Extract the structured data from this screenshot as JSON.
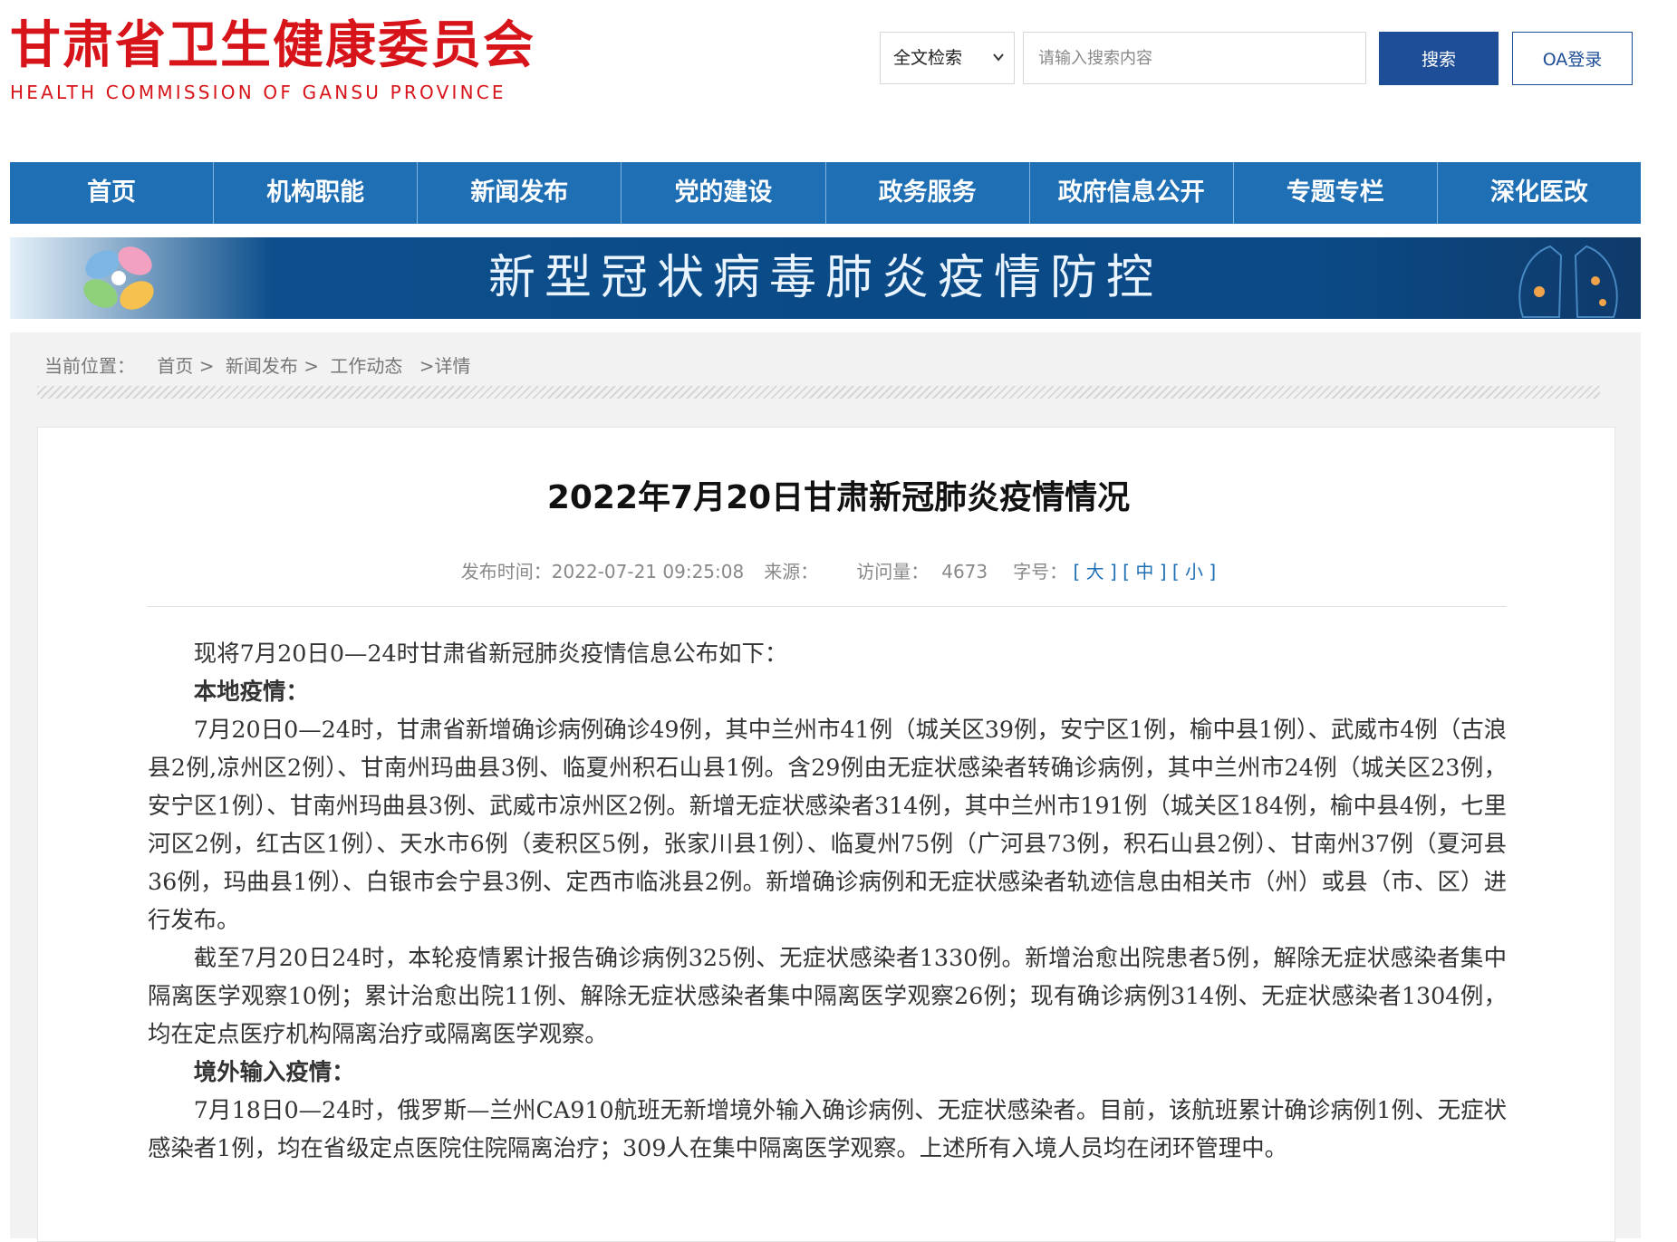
{
  "header": {
    "logo_cn": "甘肃省卫生健康委员会",
    "logo_en": "HEALTH  COMMISSION  OF  GANSU PROVINCE",
    "search_scope": "全文检索",
    "search_placeholder": "请输入搜索内容",
    "search_button": "搜索",
    "oa_button": "OA登录"
  },
  "nav": {
    "items": [
      {
        "label": "首页"
      },
      {
        "label": "机构职能"
      },
      {
        "label": "新闻发布"
      },
      {
        "label": "党的建设"
      },
      {
        "label": "政务服务"
      },
      {
        "label": "政府信息公开"
      },
      {
        "label": "专题专栏"
      },
      {
        "label": "深化医改"
      }
    ]
  },
  "banner": {
    "text": "新型冠状病毒肺炎疫情防控"
  },
  "breadcrumb": {
    "label": "当前位置：",
    "items": [
      "首页 >",
      "新闻发布 >",
      "工作动态",
      ">详情"
    ]
  },
  "article": {
    "title": "2022年7月20日甘肃新冠肺炎疫情情况",
    "publish_label": "发布时间：",
    "publish_time": "2022-07-21 09:25:08",
    "source_label": "来源：",
    "source_value": "",
    "visits_label": "访问量：",
    "visits_value": "4673",
    "font_label": "字号：",
    "font_large": "大",
    "font_medium": "中",
    "font_small": "小",
    "paragraphs": [
      {
        "text": "现将7月20日0—24时甘肃省新冠肺炎疫情信息公布如下：",
        "bold": false
      },
      {
        "text": "本地疫情：",
        "bold": true
      },
      {
        "text": "7月20日0—24时，甘肃省新增确诊病例确诊49例，其中兰州市41例（城关区39例，安宁区1例，榆中县1例）、武威市4例（古浪县2例,凉州区2例）、甘南州玛曲县3例、临夏州积石山县1例。含29例由无症状感染者转确诊病例，其中兰州市24例（城关区23例，安宁区1例）、甘南州玛曲县3例、武威市凉州区2例。新增无症状感染者314例，其中兰州市191例（城关区184例，榆中县4例，七里河区2例，红古区1例）、天水市6例（麦积区5例，张家川县1例）、临夏州75例（广河县73例，积石山县2例）、甘南州37例（夏河县36例，玛曲县1例）、白银市会宁县3例、定西市临洮县2例。新增确诊病例和无症状感染者轨迹信息由相关市（州）或县（市、区）进行发布。",
        "bold": false
      },
      {
        "text": "截至7月20日24时，本轮疫情累计报告确诊病例325例、无症状感染者1330例。新增治愈出院患者5例，解除无症状感染者集中隔离医学观察10例；累计治愈出院11例、解除无症状感染者集中隔离医学观察26例；现有确诊病例314例、无症状感染者1304例，均在定点医疗机构隔离治疗或隔离医学观察。",
        "bold": false
      },
      {
        "text": "境外输入疫情：",
        "bold": true
      },
      {
        "text": "7月18日0—24时，俄罗斯—兰州CA910航班无新增境外输入确诊病例、无症状感染者。目前，该航班累计确诊病例1例、无症状感染者1例，均在省级定点医院住院隔离治疗；309人在集中隔离医学观察。上述所有入境人员均在闭环管理中。",
        "bold": false
      }
    ]
  },
  "colors": {
    "brand_red": "#d7141a",
    "nav_blue": "#1f6fb5",
    "button_blue": "#1d4e97"
  }
}
